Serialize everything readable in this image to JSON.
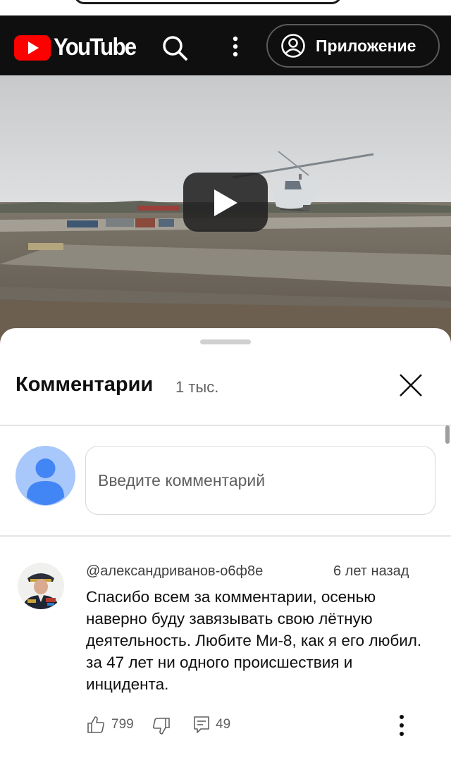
{
  "header": {
    "logo_text": "YouTube",
    "app_button_label": "Приложение",
    "brand_color": "#ff0000",
    "background": "#0f0f0f"
  },
  "video": {
    "play_icon": "play-icon"
  },
  "comments": {
    "title": "Комментарии",
    "count": "1 тыс.",
    "input_placeholder": "Введите комментарий",
    "items": [
      {
        "author": "@александриванов-о6ф8е",
        "time": "6 лет назад",
        "text": "Спасибо всем за комментарии, осенью наверно буду завязывать свою лётную деятельность. Любите Ми-8, как я его любил. за 47 лет ни одного происшествия и инцидента.",
        "likes": "799",
        "replies": "49"
      }
    ]
  }
}
